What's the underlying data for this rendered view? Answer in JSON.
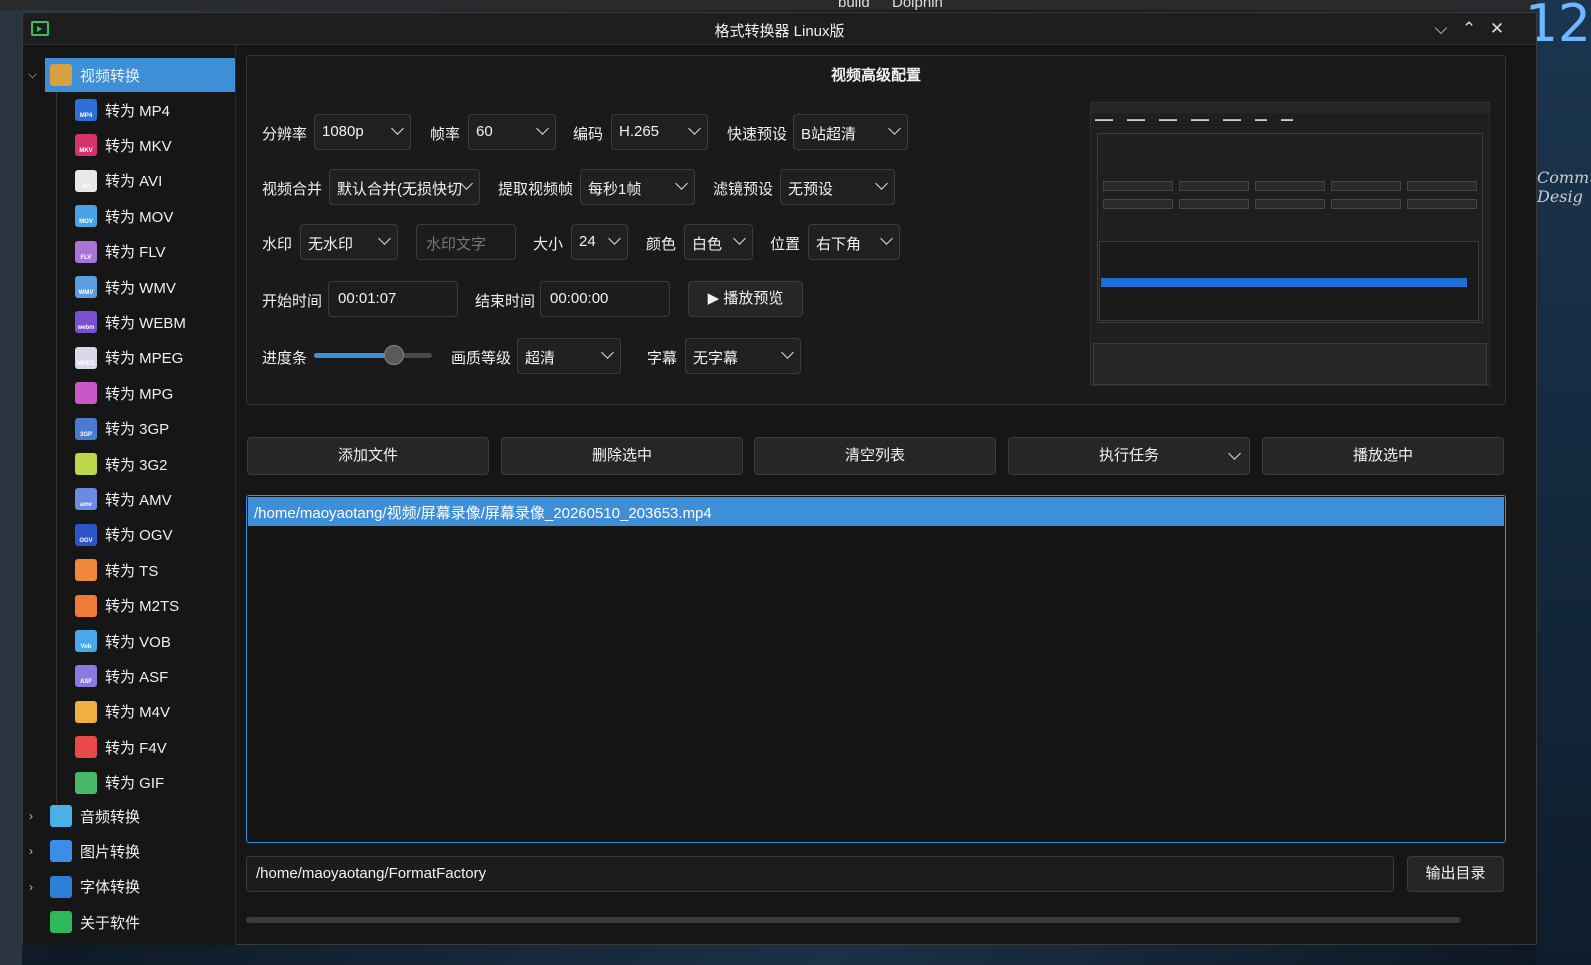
{
  "desktop": {
    "top_texts": [
      "build",
      "Dolphin"
    ],
    "clock": "12",
    "side_text": "Commu Desig"
  },
  "window": {
    "title": "格式转换器 Linux版",
    "controls": [
      "minimize",
      "maximize",
      "close"
    ]
  },
  "sidebar": {
    "categories": [
      {
        "label": "视频转换",
        "expanded": true,
        "selected": true
      },
      {
        "label": "音频转换"
      },
      {
        "label": "图片转换"
      },
      {
        "label": "字体转换"
      },
      {
        "label": "关于软件"
      }
    ],
    "video_formats": [
      {
        "label": "转为 MP4",
        "tag": "MP4",
        "color": "#2d6fd6"
      },
      {
        "label": "转为 MKV",
        "tag": "MKV",
        "color": "#d6336c"
      },
      {
        "label": "转为 AVI",
        "tag": "AVI",
        "color": "#e8e8e8"
      },
      {
        "label": "转为 MOV",
        "tag": "MOV",
        "color": "#4aa3e6"
      },
      {
        "label": "转为 FLV",
        "tag": "FLV",
        "color": "#a774d8"
      },
      {
        "label": "转为 WMV",
        "tag": "WMV",
        "color": "#5b9ee0"
      },
      {
        "label": "转为 WEBM",
        "tag": "webm",
        "color": "#7a4fd1"
      },
      {
        "label": "转为 MPEG",
        "tag": "MPEG",
        "color": "#d8d8e8"
      },
      {
        "label": "转为 MPG",
        "tag": "",
        "color": "#c858c8"
      },
      {
        "label": "转为 3GP",
        "tag": "3GP",
        "color": "#4a7bd0"
      },
      {
        "label": "转为 3G2",
        "tag": "",
        "color": "#bcd84a"
      },
      {
        "label": "转为 AMV",
        "tag": "amv",
        "color": "#6b8ae0"
      },
      {
        "label": "转为 OGV",
        "tag": "OGV",
        "color": "#2c55c8"
      },
      {
        "label": "转为 TS",
        "tag": "",
        "color": "#f08a3a"
      },
      {
        "label": "转为 M2TS",
        "tag": "",
        "color": "#f07a3a"
      },
      {
        "label": "转为 VOB",
        "tag": "Vob",
        "color": "#48a8e8"
      },
      {
        "label": "转为 ASF",
        "tag": "ASF",
        "color": "#8a7ae0"
      },
      {
        "label": "转为 M4V",
        "tag": "",
        "color": "#f0b040"
      },
      {
        "label": "转为 F4V",
        "tag": "",
        "color": "#e84848"
      },
      {
        "label": "转为 GIF",
        "tag": "",
        "color": "#48b868"
      }
    ]
  },
  "config": {
    "heading": "视频高级配置",
    "resolution": {
      "label": "分辨率",
      "value": "1080p"
    },
    "framerate": {
      "label": "帧率",
      "value": "60"
    },
    "codec": {
      "label": "编码",
      "value": "H.265"
    },
    "quick_preset": {
      "label": "快速预设",
      "value": "B站超清"
    },
    "merge": {
      "label": "视频合并",
      "value": "默认合并(无损快切"
    },
    "extract": {
      "label": "提取视频帧",
      "value": "每秒1帧"
    },
    "filter": {
      "label": "滤镜预设",
      "value": "无预设"
    },
    "watermark": {
      "label": "水印",
      "value": "无水印"
    },
    "watermark_text": {
      "placeholder": "水印文字"
    },
    "size": {
      "label": "大小",
      "value": "24"
    },
    "color": {
      "label": "颜色",
      "value": "白色"
    },
    "position": {
      "label": "位置",
      "value": "右下角"
    },
    "start_time": {
      "label": "开始时间",
      "value": "00:01:07"
    },
    "end_time": {
      "label": "结束时间",
      "value": "00:00:00"
    },
    "play_preview": "▶  播放预览",
    "progress": {
      "label": "进度条",
      "value": 0.68
    },
    "quality": {
      "label": "画质等级",
      "value": "超清"
    },
    "subtitle": {
      "label": "字幕",
      "value": "无字幕"
    }
  },
  "actions": {
    "add": "添加文件",
    "delete": "删除选中",
    "clear": "清空列表",
    "execute": "执行任务",
    "play": "播放选中"
  },
  "file_list": [
    "/home/maoyaotang/视频/屏幕录像/屏幕录像_20260510_203653.mp4"
  ],
  "output": {
    "path": "/home/maoyaotang/FormatFactory",
    "button": "输出目录"
  }
}
